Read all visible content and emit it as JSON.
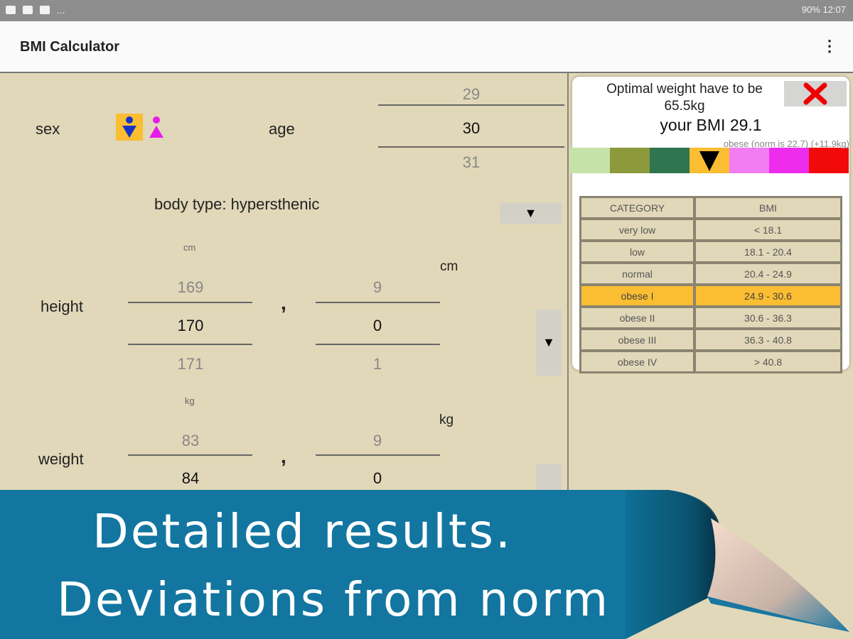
{
  "status_bar": {
    "right_text": "90% 12:07",
    "dots": "..."
  },
  "app": {
    "title": "BMI Calculator",
    "menu_icon": "⋮"
  },
  "form": {
    "sex_label": "sex",
    "age_label": "age",
    "age_picker": [
      "29",
      "30",
      "31"
    ],
    "body_type_label": "body type: hypersthenic",
    "dropdown_arrow": "▼",
    "height": {
      "label": "height",
      "unit_small": "cm",
      "unit": "cm",
      "whole": [
        "169",
        "170",
        "171"
      ],
      "separator": ",",
      "decimal": [
        "9",
        "0",
        "1"
      ]
    },
    "weight": {
      "label": "weight",
      "unit_small": "kg",
      "unit": "kg",
      "whole": [
        "83",
        "84"
      ],
      "separator": ",",
      "decimal": [
        "9",
        "0"
      ]
    }
  },
  "result": {
    "optimal_text": "Optimal weight have to be 65.5kg",
    "close_icon": "✖",
    "bmi_text": "your BMI 29.1",
    "deviation_text": "obese (norm is 22.7)   (+11.9kg)",
    "scale_colors": [
      "#c5e3a8",
      "#8c9a3c",
      "#2e7550",
      "#fbbd31",
      "#f27df2",
      "#ee2cee",
      "#f20a0a"
    ],
    "marker_index": 3,
    "table": {
      "headers": [
        "CATEGORY",
        "BMI"
      ],
      "rows": [
        [
          "very low",
          "< 18.1"
        ],
        [
          "low",
          "18.1 - 20.4"
        ],
        [
          "normal",
          "20.4 - 24.9"
        ],
        [
          "obese I",
          "24.9 - 30.6"
        ],
        [
          "obese II",
          "30.6 - 36.3"
        ],
        [
          "obese III",
          "36.3 - 40.8"
        ],
        [
          "obese IV",
          "> 40.8"
        ]
      ],
      "highlight_row": 3
    }
  },
  "banner": {
    "line1": "Detailed results.",
    "line2": "Deviations from norm"
  }
}
